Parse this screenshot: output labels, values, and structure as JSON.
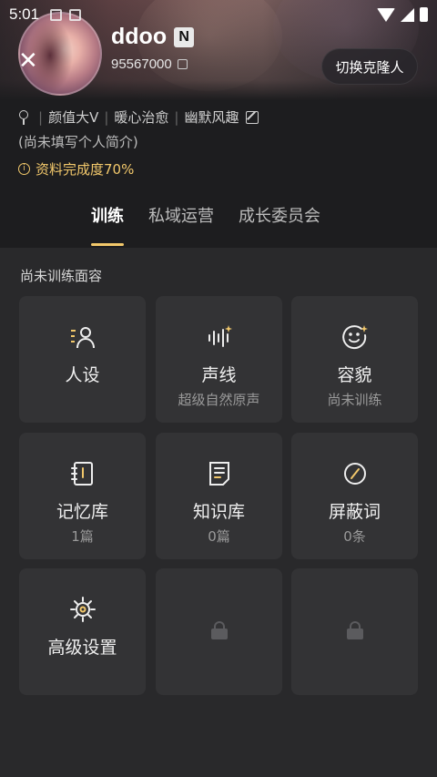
{
  "status_bar": {
    "time": "5:01"
  },
  "profile": {
    "username": "ddoo",
    "badge": "N",
    "uid": "95567000",
    "switch_button": "切换克隆人",
    "tags": [
      "颜值大V",
      "暖心治愈",
      "幽默风趣"
    ],
    "bio": "(尚未填写个人简介)",
    "completion": "资料完成度70%"
  },
  "tabs": [
    {
      "label": "训练",
      "active": true
    },
    {
      "label": "私域运营",
      "active": false
    },
    {
      "label": "成长委员会",
      "active": false
    }
  ],
  "section_title": "尚未训练面容",
  "cards": [
    {
      "icon": "persona-icon",
      "label": "人设",
      "sub": ""
    },
    {
      "icon": "voice-wave-icon",
      "label": "声线",
      "sub": "超级自然原声"
    },
    {
      "icon": "face-sparkle-icon",
      "label": "容貌",
      "sub": "尚未训练"
    },
    {
      "icon": "notebook-icon",
      "label": "记忆库",
      "sub": "1篇"
    },
    {
      "icon": "document-icon",
      "label": "知识库",
      "sub": "0篇"
    },
    {
      "icon": "block-icon",
      "label": "屏蔽词",
      "sub": "0条"
    },
    {
      "icon": "gear-icon",
      "label": "高级设置",
      "sub": ""
    },
    {
      "icon": "lock-icon",
      "label": "",
      "sub": ""
    },
    {
      "icon": "lock-icon",
      "label": "",
      "sub": ""
    }
  ],
  "colors": {
    "accent": "#f2c86b",
    "background": "#1d1d1f",
    "panel": "#29292b",
    "card": "#333335"
  }
}
